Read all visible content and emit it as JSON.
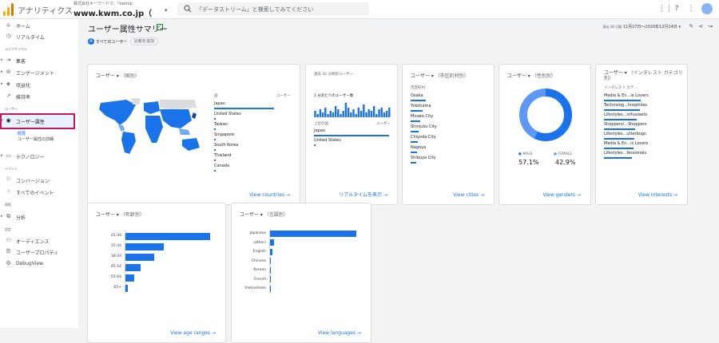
{
  "header": {
    "app_title": "アナリティクス",
    "account": "株式会社キーワードマ、『kwmip",
    "property": "www.kwm.co.jp（",
    "search_placeholder": "「データストリーム」と検索してみてください"
  },
  "sidebar": {
    "items": [
      {
        "label": "ホーム",
        "icon": "home-icon"
      },
      {
        "label": "リアルタイム",
        "icon": "clock-icon"
      },
      {
        "label": "集客",
        "icon": "acquisition-icon"
      },
      {
        "label": "エンゲージメント",
        "icon": "engagement-icon"
      },
      {
        "label": "収益化",
        "icon": "monetization-icon"
      },
      {
        "label": "維持率",
        "icon": "retention-icon"
      },
      {
        "label": "ユーザー属性",
        "icon": "globe-icon"
      },
      {
        "label": "テクノロジー",
        "icon": "technology-icon"
      },
      {
        "label": "コンバージョン",
        "icon": "flag-icon"
      },
      {
        "label": "すべてのイベント",
        "icon": "touch-icon"
      },
      {
        "label": "分析",
        "icon": "analysis-icon"
      },
      {
        "label": "オーディエンス",
        "icon": "audience-icon"
      },
      {
        "label": "ユーザープロパティ",
        "icon": "user-property-icon"
      },
      {
        "label": "DebugView",
        "icon": "debug-icon"
      }
    ],
    "sections": [
      "ライフサイクル",
      "ユーザー",
      "イベント",
      "探索",
      "設定"
    ],
    "subitems": [
      "概要",
      "ユーザー属性の詳細"
    ]
  },
  "main": {
    "title": "ユーザー属性サマリー",
    "chip_all": "すべてのユーザー",
    "chip_add": "比較を追加",
    "date_prefix": "過去 28 日間",
    "date_range": "11月27日～2020年12月24日",
    "accent": "#1a73e8"
  },
  "cards": {
    "country": {
      "title_metric": "ユーザー",
      "title_dim": "（国別）",
      "col_dim": "国",
      "col_metric": "ユーザー",
      "rows": [
        {
          "label": "Japan",
          "value": 1.0
        },
        {
          "label": "United States",
          "value": 0.02
        },
        {
          "label": "Taiwan",
          "value": 0.01
        },
        {
          "label": "Singapore",
          "value": 0.01
        },
        {
          "label": "South Korea",
          "value": 0.01
        },
        {
          "label": "Thailand",
          "value": 0.005
        },
        {
          "label": "Canada",
          "value": 0.005
        }
      ],
      "link": "View countries"
    },
    "realtime": {
      "title": "過去 30 分間のユーザー",
      "sub_title": "1 分あたりのユーザー数",
      "top_label": "上位の国",
      "col_metric": "ユーザー",
      "minute_bars": [
        0.4,
        0.2,
        0.5,
        0.3,
        0.6,
        0.2,
        0.4,
        0.3,
        0.7,
        0.5,
        0.2,
        0.4,
        0.9,
        0.6,
        0.3,
        0.5,
        0.2,
        0.6,
        0.4,
        0.8,
        0.3,
        0.5,
        0.4,
        0.7,
        0.2,
        0.5,
        0.6,
        0.3,
        0.4,
        0.6
      ],
      "rows": [
        {
          "label": "Japan",
          "value": 1.0
        },
        {
          "label": "United States",
          "value": 0.02
        }
      ],
      "link": "リアルタイムを表示"
    },
    "city": {
      "title_metric": "ユーザー",
      "title_dim": "（市区町村別）",
      "col_dim": "市区町村",
      "rows": [
        {
          "label": "Osaka",
          "value": 0.2
        },
        {
          "label": "Yokohama",
          "value": 0.16
        },
        {
          "label": "Minato City",
          "value": 0.12
        },
        {
          "label": "Shinjuku City",
          "value": 0.1
        },
        {
          "label": "Chiyoda City",
          "value": 0.09
        },
        {
          "label": "Nagoya",
          "value": 0.08
        },
        {
          "label": "Shibuya City",
          "value": 0.07
        }
      ],
      "link": "View cities"
    },
    "gender": {
      "title_metric": "ユーザー",
      "title_dim": "（性別別）",
      "male_label": "MALE",
      "male_value": "57.1%",
      "female_label": "FEMALE",
      "female_value": "42.9%",
      "male_fraction": 0.571,
      "male_color": "#1a73e8",
      "female_color": "#5e97f6",
      "link": "View genders"
    },
    "interests": {
      "title_metric": "ユーザー",
      "title_dim": "（インタレスト カテゴリ別）",
      "col_dim": "インタレスト カテ...",
      "rows": [
        {
          "label": "Media & En...ie Lovers",
          "value": 0.68
        },
        {
          "label": "Technolog...hnophiles",
          "value": 0.66
        },
        {
          "label": "Lifestyles...nthusiasts",
          "value": 0.6
        },
        {
          "label": "Shoppers/...Shoppers",
          "value": 0.58
        },
        {
          "label": "Lifestyles...utterbugs",
          "value": 0.56
        },
        {
          "label": "Media & En...ic Lovers",
          "value": 0.54
        },
        {
          "label": "Lifestyles...fessionals",
          "value": 0.52
        }
      ],
      "link": "View interests"
    },
    "age": {
      "title_metric": "ユーザー",
      "title_dim": "（年齢別）",
      "link": "View age ranges"
    },
    "language": {
      "title_metric": "ユーザー",
      "title_dim": "（言語別）",
      "link": "View languages"
    }
  },
  "chart_data": [
    {
      "type": "bar",
      "orientation": "horizontal",
      "categories": [
        "25-34",
        "35-44",
        "18-24",
        "45-54",
        "55-64",
        "65+"
      ],
      "values": [
        100,
        45,
        34,
        18,
        10,
        3
      ],
      "title": "",
      "xlabel": "",
      "ylabel": ""
    },
    {
      "type": "bar",
      "orientation": "horizontal",
      "categories": [
        "Japanese",
        "(other)",
        "English",
        "Chinese",
        "Korean",
        "French",
        "Vietnamese"
      ],
      "values": [
        100,
        5,
        3,
        0.6,
        0.4,
        0.3,
        0.2
      ],
      "title": "",
      "xlabel": "",
      "ylabel": ""
    }
  ]
}
